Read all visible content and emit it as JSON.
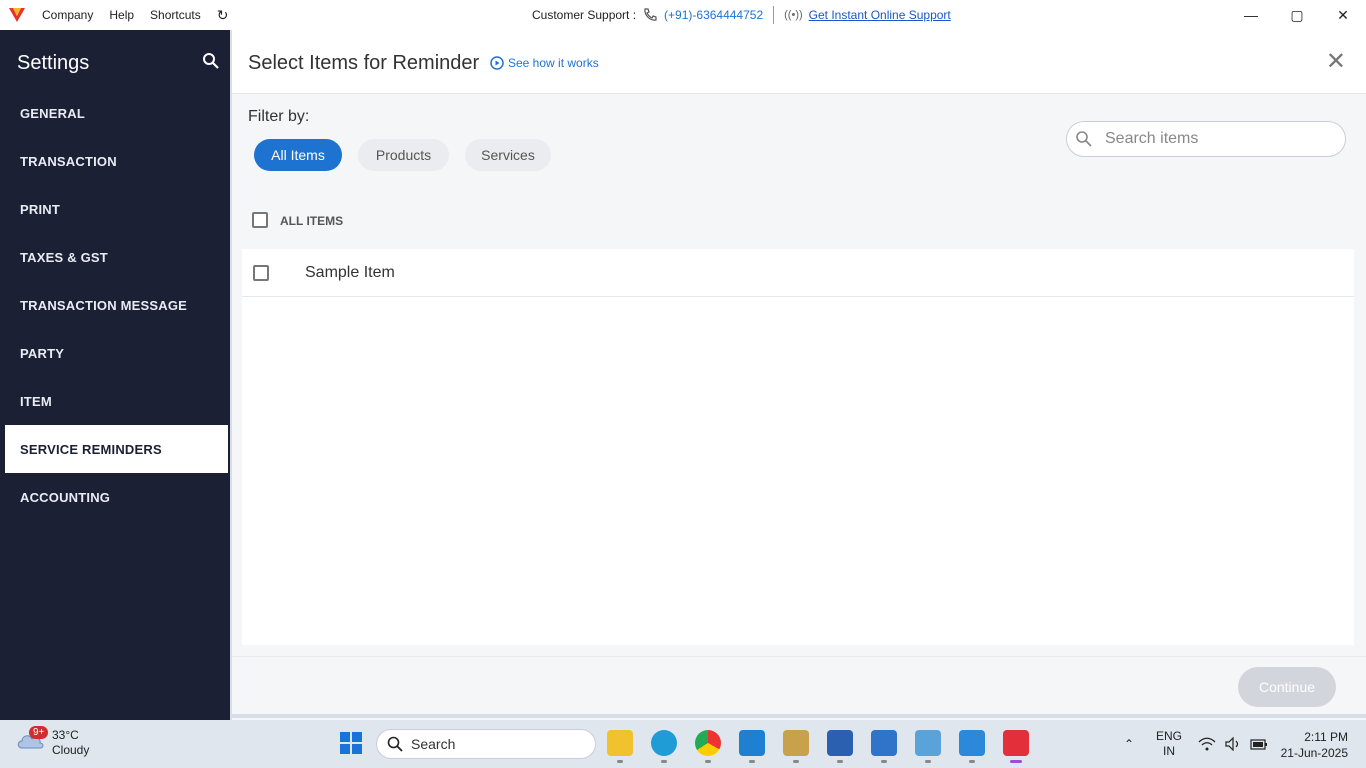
{
  "titlebar": {
    "menu": [
      "Company",
      "Help",
      "Shortcuts"
    ],
    "support_label": "Customer Support :",
    "support_phone": "(+91)-6364444752",
    "support_link": "Get Instant Online Support"
  },
  "sidebar": {
    "title": "Settings",
    "items": [
      {
        "label": "GENERAL"
      },
      {
        "label": "TRANSACTION"
      },
      {
        "label": "PRINT"
      },
      {
        "label": "TAXES & GST"
      },
      {
        "label": "TRANSACTION MESSAGE"
      },
      {
        "label": "PARTY"
      },
      {
        "label": "ITEM"
      },
      {
        "label": "SERVICE REMINDERS"
      },
      {
        "label": "ACCOUNTING"
      }
    ],
    "active_index": 7
  },
  "main": {
    "title": "Select Items for Reminder",
    "how_link": "See how it works",
    "filter_label": "Filter by:",
    "filters": [
      "All Items",
      "Products",
      "Services"
    ],
    "search_placeholder": "Search items",
    "all_items_label": "ALL ITEMS",
    "items": [
      "Sample Item"
    ],
    "continue_label": "Continue"
  },
  "taskbar": {
    "badge": "9+",
    "temperature": "33°C",
    "weather": "Cloudy",
    "search": "Search",
    "lang": "ENG",
    "region": "IN",
    "time": "2:11 PM",
    "date": "21-Jun-2025"
  },
  "colors": {
    "accent": "#1e73d0",
    "sidebar_bg": "#1c2035",
    "continue_disabled": "#d3d5dd"
  }
}
